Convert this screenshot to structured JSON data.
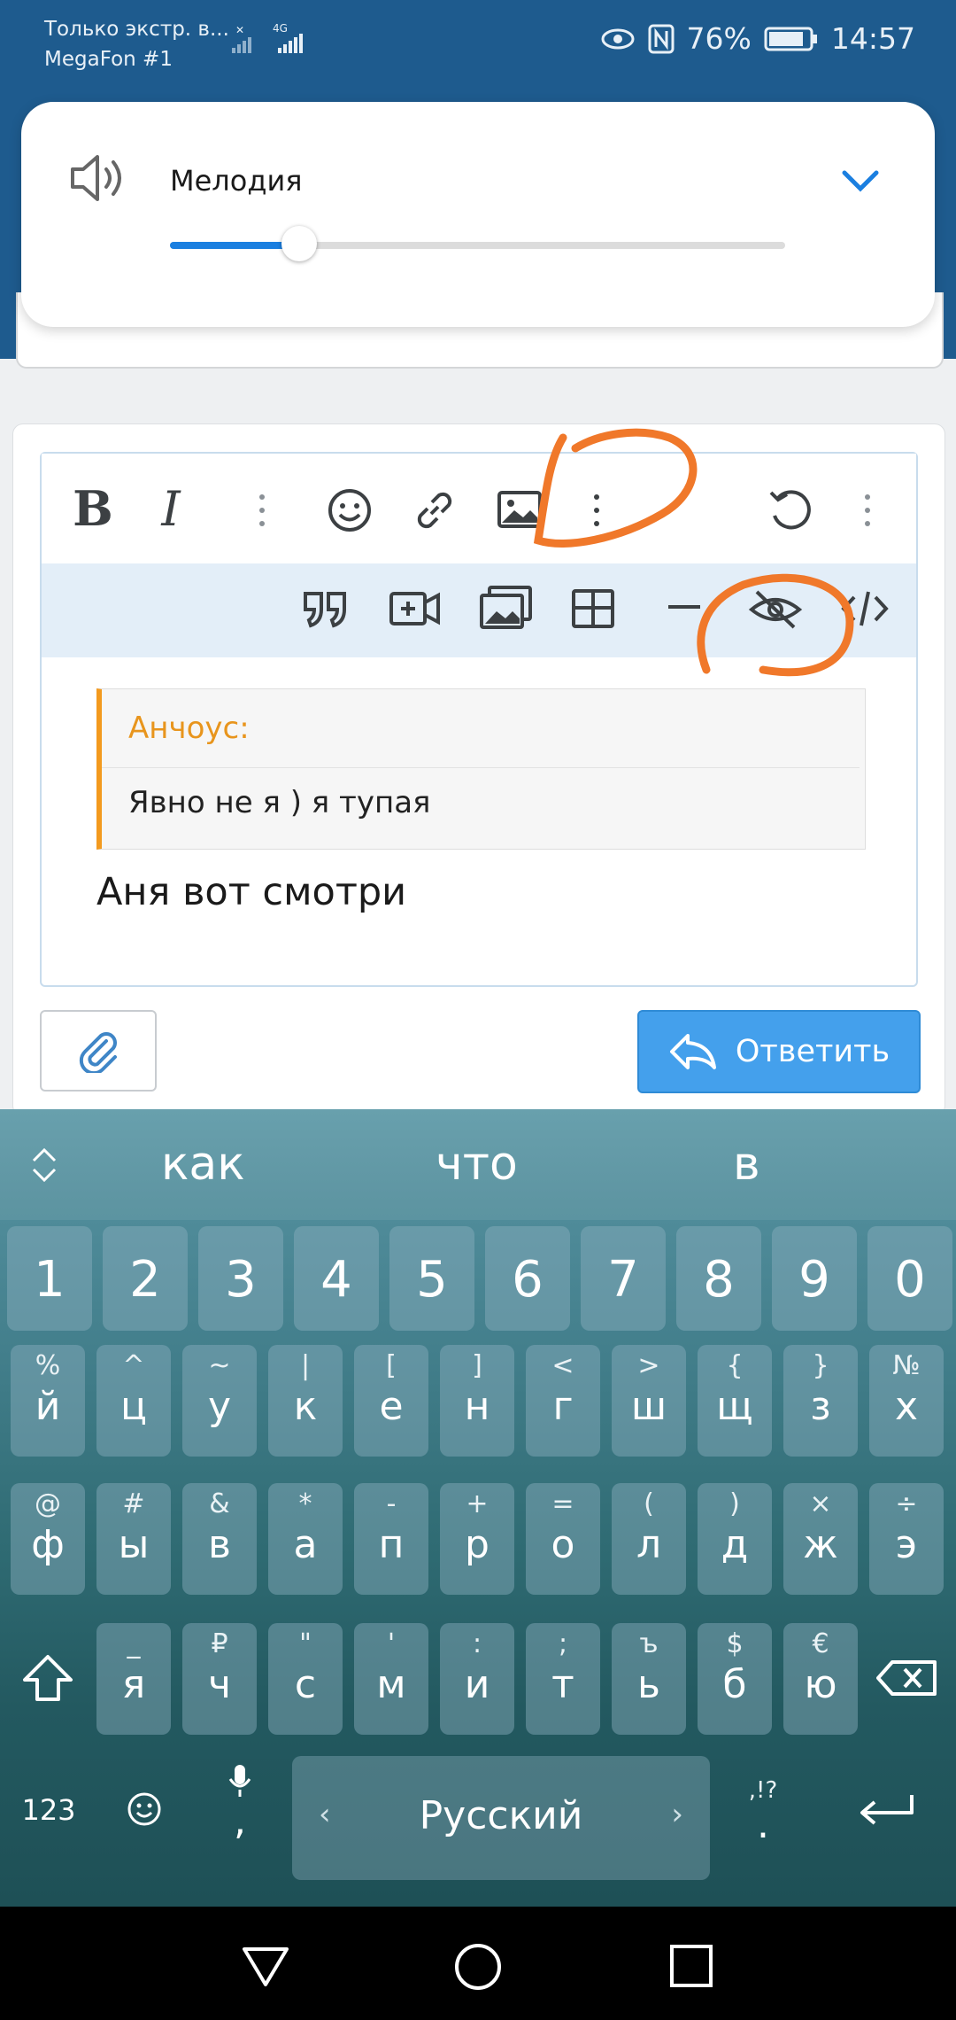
{
  "status": {
    "sim1": "Только экстр. в...",
    "sim2": "MegaFon #1",
    "net": "4G",
    "battery": "76%",
    "time": "14:57"
  },
  "volume": {
    "label": "Мелодия",
    "level": 0.21,
    "accent": "#1b7fe0"
  },
  "editor": {
    "toolbar1": [
      "bold-icon",
      "italic-icon",
      "more-vertical-icon",
      "smile-icon",
      "link-icon",
      "image-icon",
      "more-vertical-icon",
      "undo-icon",
      "more-vertical-icon"
    ],
    "toolbar2": [
      "quote-icon",
      "video-icon",
      "gallery-icon",
      "table-icon",
      "horizontal-rule-icon",
      "spoiler-hide-icon",
      "code-icon"
    ],
    "quote_author": "Анчоус:",
    "quote_text": "Явно не я ) я тупая",
    "message": "Аня вот смотри"
  },
  "actions": {
    "reply_label": "Ответить"
  },
  "keyboard": {
    "suggestions": [
      "как",
      "что",
      "в"
    ],
    "numbers": [
      "1",
      "2",
      "3",
      "4",
      "5",
      "6",
      "7",
      "8",
      "9",
      "0"
    ],
    "row1": [
      [
        "%",
        "й"
      ],
      [
        "^",
        "ц"
      ],
      [
        "~",
        "у"
      ],
      [
        "|",
        "к"
      ],
      [
        "[",
        "е"
      ],
      [
        "]",
        "н"
      ],
      [
        "<",
        "г"
      ],
      [
        ">",
        "ш"
      ],
      [
        "{",
        "щ"
      ],
      [
        "}",
        "з"
      ],
      [
        "№",
        "х"
      ]
    ],
    "row2": [
      [
        "@",
        "ф"
      ],
      [
        "#",
        "ы"
      ],
      [
        "&",
        "в"
      ],
      [
        "*",
        "а"
      ],
      [
        "-",
        "п"
      ],
      [
        "+",
        "р"
      ],
      [
        "=",
        "о"
      ],
      [
        "(",
        "л"
      ],
      [
        ")",
        "д"
      ],
      [
        "×",
        "ж"
      ],
      [
        "÷",
        "э"
      ]
    ],
    "row3": [
      [
        "_",
        "я"
      ],
      [
        "₽",
        "ч"
      ],
      [
        "\"",
        "с"
      ],
      [
        "'",
        "м"
      ],
      [
        ":",
        "и"
      ],
      [
        ";",
        "т"
      ],
      [
        "ъ",
        "ь"
      ],
      [
        "$",
        "б"
      ],
      [
        "€",
        "ю"
      ]
    ],
    "mode_label": "123",
    "comma": ",",
    "punct_top": ",!?",
    "punct_bottom": ".",
    "space_label": "Русский"
  },
  "colors": {
    "header": "#1e5b8e",
    "reply_button": "#44a0ec",
    "quote_accent": "#f39a1e",
    "annotation": "#f0782a"
  }
}
